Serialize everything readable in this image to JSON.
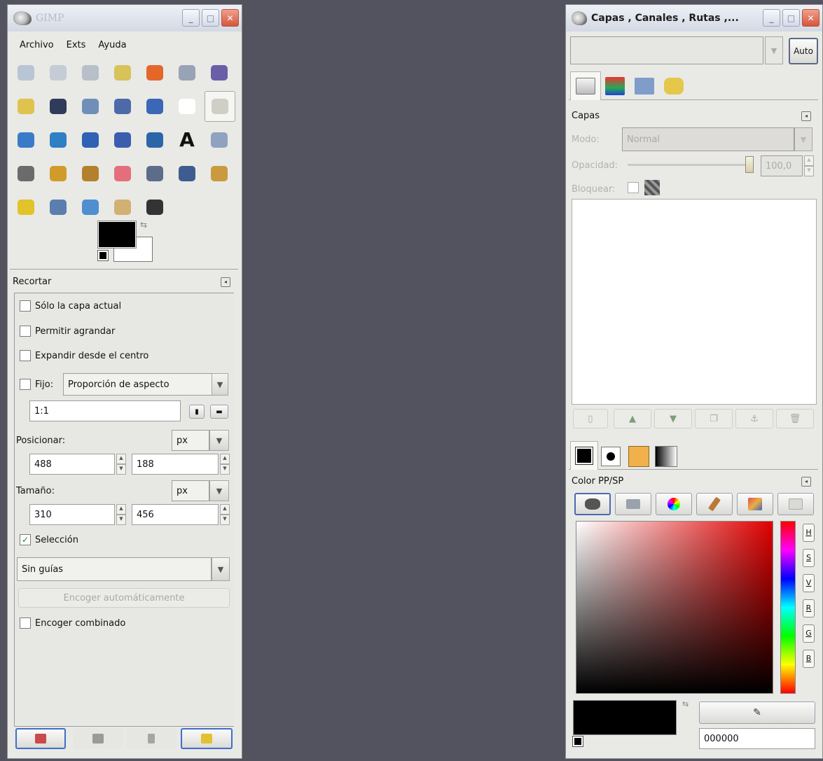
{
  "toolbox": {
    "title": "GIMP",
    "menu": [
      "Archivo",
      "Exts",
      "Ayuda"
    ],
    "tools": [
      {
        "name": "rect-select-icon",
        "color": "#b9c4d4"
      },
      {
        "name": "ellipse-select-icon",
        "color": "#c5ccd6"
      },
      {
        "name": "lasso-icon",
        "color": "#b8bfc9"
      },
      {
        "name": "fuzzy-select-icon",
        "color": "#d8c25a"
      },
      {
        "name": "color-select-icon",
        "color": "#e4672a"
      },
      {
        "name": "scissors-icon",
        "color": "#98a3b5"
      },
      {
        "name": "foreground-select-icon",
        "color": "#6a5fa6"
      },
      {
        "name": "paths-icon",
        "color": "#e0c24f"
      },
      {
        "name": "color-picker-icon",
        "color": "#2f3b5a"
      },
      {
        "name": "zoom-icon",
        "color": "#6f8fb9"
      },
      {
        "name": "measure-icon",
        "color": "#4d6aa8"
      },
      {
        "name": "move-icon",
        "color": "#3a67b6"
      },
      {
        "name": "align-icon",
        "color": "#ffffff"
      },
      {
        "name": "crop-icon",
        "color": "#cfcfc5"
      },
      {
        "name": "rotate-icon",
        "color": "#3a7bc9"
      },
      {
        "name": "scale-icon",
        "color": "#2f7fc4"
      },
      {
        "name": "shear-icon",
        "color": "#2f61b4"
      },
      {
        "name": "perspective-icon",
        "color": "#3a5dae"
      },
      {
        "name": "flip-icon",
        "color": "#2b66a9"
      },
      {
        "name": "text-icon",
        "color": "#111111"
      },
      {
        "name": "bucket-fill-icon",
        "color": "#8fa3c0"
      },
      {
        "name": "blend-icon",
        "color": "#6b6b6b"
      },
      {
        "name": "pencil-icon",
        "color": "#d19b2b"
      },
      {
        "name": "paintbrush-icon",
        "color": "#b3802e"
      },
      {
        "name": "eraser-icon",
        "color": "#e46e7c"
      },
      {
        "name": "airbrush-icon",
        "color": "#5d6d89"
      },
      {
        "name": "ink-icon",
        "color": "#3e5c8f"
      },
      {
        "name": "clone-icon",
        "color": "#c99a3f"
      },
      {
        "name": "heal-icon",
        "color": "#e1c32a"
      },
      {
        "name": "perspective-clone-icon",
        "color": "#5a7fae"
      },
      {
        "name": "blur-icon",
        "color": "#4f8fcf"
      },
      {
        "name": "smudge-icon",
        "color": "#d2b073"
      },
      {
        "name": "dodge-burn-icon",
        "color": "#333333"
      }
    ],
    "selected_tool_index": 13
  },
  "tool_options": {
    "title": "Recortar",
    "current_layer_only": {
      "label": "Sólo la capa actual",
      "checked": false
    },
    "allow_growing": {
      "label": "Permitir agrandar",
      "checked": false
    },
    "expand_center": {
      "label": "Expandir desde el centro",
      "checked": false
    },
    "fixed": {
      "label": "Fijo:",
      "checked": false,
      "mode": "Proporción de aspecto",
      "value": "1:1"
    },
    "position": {
      "label": "Posicionar:",
      "unit": "px",
      "x": "488",
      "y": "188"
    },
    "size": {
      "label": "Tamaño:",
      "unit": "px",
      "w": "310",
      "h": "456"
    },
    "highlight": {
      "label": "Selección",
      "checked": true
    },
    "guides": "Sin guías",
    "auto_shrink": "Encoger automáticamente",
    "shrink_merged": {
      "label": "Encoger combinado",
      "checked": false
    }
  },
  "dock": {
    "title": "Capas , Canales , Rutas ,...",
    "auto_label": "Auto",
    "layers": {
      "title": "Capas",
      "mode_label": "Modo:",
      "mode_value": "Normal",
      "opacity_label": "Opacidad:",
      "opacity_value": "100,0",
      "opacity_level": 1.0,
      "lock_label": "Bloquear:"
    },
    "colors": {
      "title": "Color PP/SP",
      "hex_value": "000000",
      "channels": [
        "H",
        "S",
        "V",
        "R",
        "G",
        "B"
      ]
    }
  }
}
